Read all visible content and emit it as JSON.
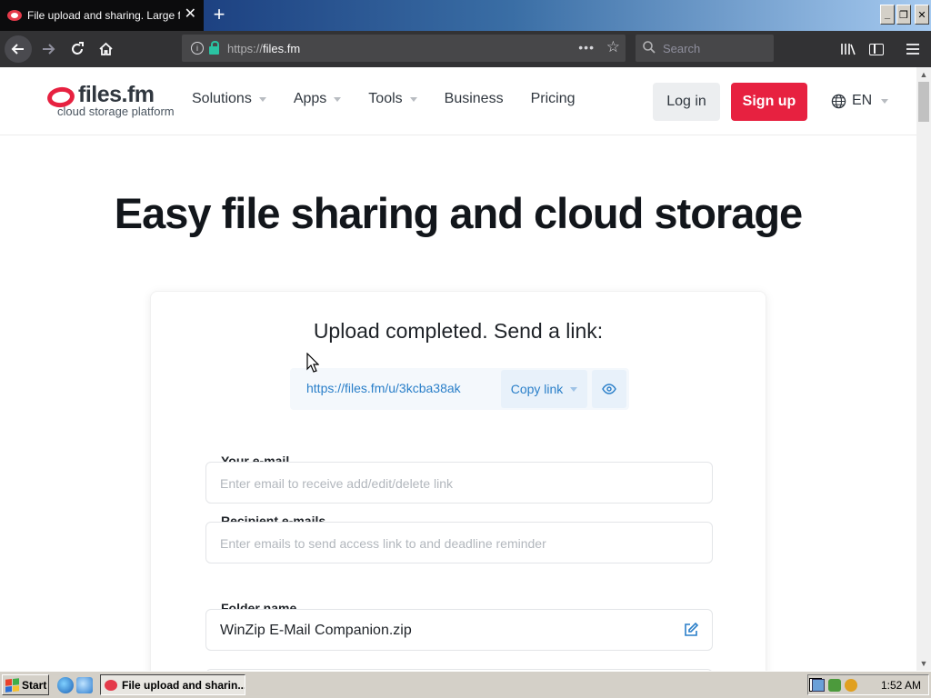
{
  "browser": {
    "tab_title": "File upload and sharing. Large file",
    "tab_close": "✕",
    "new_tab": "+",
    "url_protocol": "https://",
    "url_host": "files.fm",
    "search_placeholder": "Search",
    "window_buttons": {
      "minimize": "_",
      "restore": "❐",
      "close": "✕"
    }
  },
  "site": {
    "logo_name": "files.fm",
    "logo_tagline": "cloud storage platform",
    "nav": [
      {
        "label": "Solutions",
        "has_dropdown": true
      },
      {
        "label": "Apps",
        "has_dropdown": true
      },
      {
        "label": "Tools",
        "has_dropdown": true
      },
      {
        "label": "Business",
        "has_dropdown": false
      },
      {
        "label": "Pricing",
        "has_dropdown": false
      }
    ],
    "login_label": "Log in",
    "signup_label": "Sign up",
    "language": "EN",
    "brand_color": "#e72140",
    "link_color": "#2a7fc9"
  },
  "hero_title": "Easy file sharing and cloud storage",
  "upload": {
    "title": "Upload completed. Send a link:",
    "link": "https://files.fm/u/3kcba38ak",
    "copy_label": "Copy link"
  },
  "form": {
    "your_email_label": "Your e-mail",
    "your_email_placeholder": "Enter email to receive add/edit/delete link",
    "recipient_label": "Recipient e-mails",
    "recipient_placeholder": "Enter emails to send access link to and deadline reminder",
    "folder_label": "Folder name",
    "folder_value": "WinZip E-Mail Companion.zip"
  },
  "taskbar": {
    "start_label": "Start",
    "task_label": "File upload and sharin...",
    "clock": "1:52 AM"
  }
}
